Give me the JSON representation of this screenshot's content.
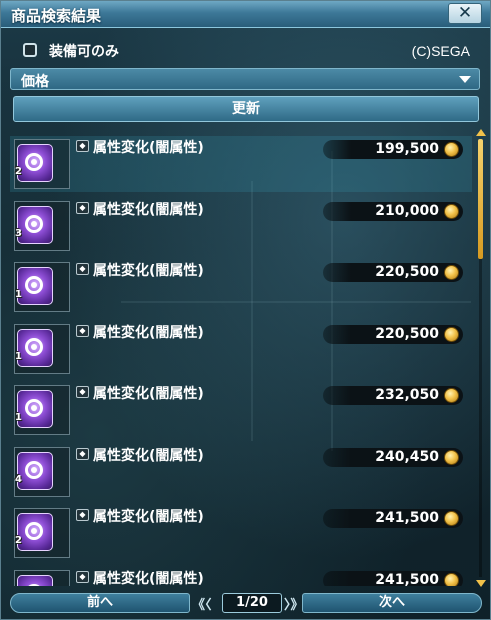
{
  "window": {
    "title": "商品検索結果",
    "close_label": "✕"
  },
  "filter": {
    "equip_only_label": "装備可のみ",
    "equip_only_checked": false
  },
  "copyright": "(C)SEGA",
  "sort": {
    "selected": "価格"
  },
  "refresh_label": "更新",
  "results": [
    {
      "name": "属性変化(闇属性)",
      "price": "199,500",
      "level": "2",
      "selected": true
    },
    {
      "name": "属性変化(闇属性)",
      "price": "210,000",
      "level": "3",
      "selected": false
    },
    {
      "name": "属性変化(闇属性)",
      "price": "220,500",
      "level": "1",
      "selected": false
    },
    {
      "name": "属性変化(闇属性)",
      "price": "220,500",
      "level": "1",
      "selected": false
    },
    {
      "name": "属性変化(闇属性)",
      "price": "232,050",
      "level": "1",
      "selected": false
    },
    {
      "name": "属性変化(闇属性)",
      "price": "240,450",
      "level": "4",
      "selected": false
    },
    {
      "name": "属性変化(闇属性)",
      "price": "241,500",
      "level": "2",
      "selected": false
    },
    {
      "name": "属性変化(闇属性)",
      "price": "241,500",
      "level": "",
      "selected": false
    }
  ],
  "pager": {
    "prev_label": "前へ",
    "next_label": "次へ",
    "page_text": "1/20",
    "left_chevrons": "《〈",
    "right_chevrons": "〉》"
  },
  "colors": {
    "accent": "#3d7898",
    "price_icon": "#f2c24a",
    "disc": "#8f4fd6"
  }
}
